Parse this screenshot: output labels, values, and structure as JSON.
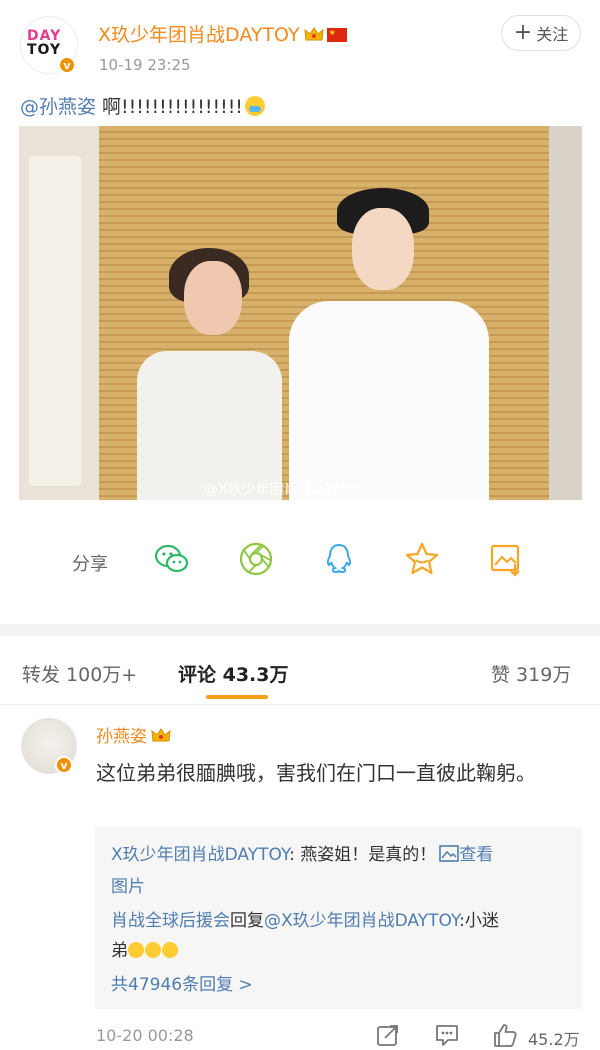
{
  "post": {
    "username": "X玖少年团肖战DAYTOY",
    "avatar_logo": [
      "DAY",
      "TOY"
    ],
    "time": "10-19 23:25",
    "follow_label": "关注",
    "mention": "@孙燕姿",
    "text": " 啊!!!!!!!!!!!!!!!!",
    "watermark": "@X玖少年团肖战DAYTOY"
  },
  "share": {
    "label": "分享",
    "icons": [
      "wechat-icon",
      "moments-icon",
      "qq-icon",
      "favorite-star-icon",
      "save-image-icon"
    ]
  },
  "tabs": {
    "repost": "转发 100万+",
    "comments": "评论 43.3万",
    "likes": "赞 319万"
  },
  "comment": {
    "username": "孙燕姿",
    "text": "这位弟弟很腼腆哦，害我们在门口一直彼此鞠躬。",
    "replies": {
      "r1_user": "X玖少年团肖战DAYTOY",
      "r1_text": ": 燕姿姐！是真的！",
      "r1_link": "查看",
      "r1_link2": "图片",
      "r2_user": "肖战全球后援会",
      "r2_mid": "回复",
      "r2_target": "@X玖少年团肖战DAYTOY",
      "r2_text": ":小迷",
      "r2_text2": "弟",
      "more": "共47946条回复 >"
    },
    "time": "10-20 00:28",
    "likes": "45.2万"
  },
  "colors": {
    "accent_orange": "#f28a1c",
    "link_blue": "#507daf",
    "tab_underline": "#f8a01c"
  }
}
